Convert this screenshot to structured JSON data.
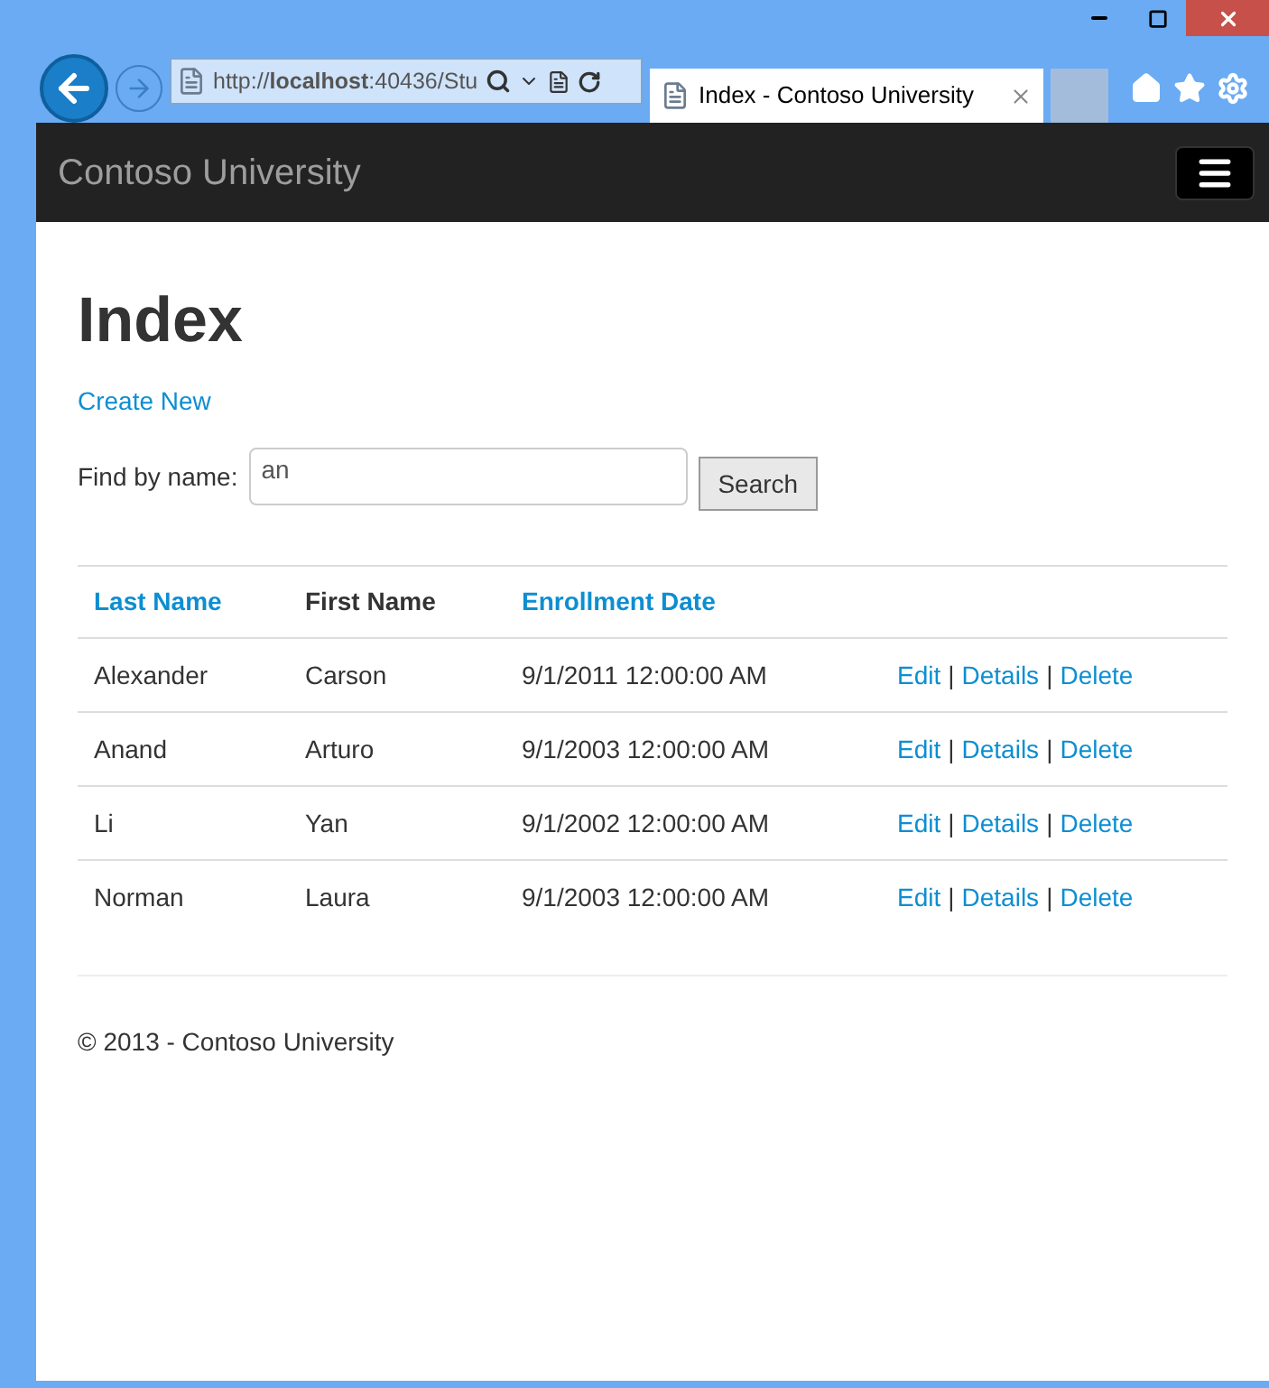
{
  "browser": {
    "address": "http://**localhost**:40436/Stu",
    "tab_title": "Index - Contoso University"
  },
  "navbar": {
    "brand": "Contoso University"
  },
  "page": {
    "heading": "Index",
    "create_link": "Create New",
    "search": {
      "label": "Find by name:",
      "value": "an",
      "button": "Search"
    }
  },
  "table": {
    "columns": [
      {
        "label": "Last Name",
        "kind": "link"
      },
      {
        "label": "First Name",
        "kind": "plain"
      },
      {
        "label": "Enrollment Date",
        "kind": "link"
      }
    ],
    "rows": [
      {
        "last_name": "Alexander",
        "first_name": "Carson",
        "enrollment_date": "9/1/2011 12:00:00 AM",
        "actions": [
          "Edit",
          "Details",
          "Delete"
        ]
      },
      {
        "last_name": "Anand",
        "first_name": "Arturo",
        "enrollment_date": "9/1/2003 12:00:00 AM",
        "actions": [
          "Edit",
          "Details",
          "Delete"
        ]
      },
      {
        "last_name": "Li",
        "first_name": "Yan",
        "enrollment_date": "9/1/2002 12:00:00 AM",
        "actions": [
          "Edit",
          "Details",
          "Delete"
        ]
      },
      {
        "last_name": "Norman",
        "first_name": "Laura",
        "enrollment_date": "9/1/2003 12:00:00 AM",
        "actions": [
          "Edit",
          "Details",
          "Delete"
        ]
      }
    ],
    "separator": "|"
  },
  "footer": "© 2013 - Contoso University"
}
